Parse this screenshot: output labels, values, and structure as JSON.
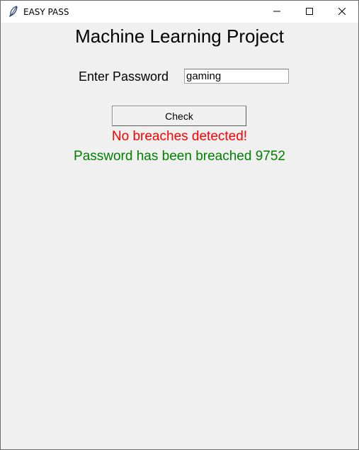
{
  "window": {
    "title": "EASY PASS",
    "icon": "feather-icon",
    "controls": [
      "minimize-icon",
      "maximize-icon",
      "close-icon"
    ]
  },
  "main": {
    "heading": "Machine Learning Project",
    "password_label": "Enter Password",
    "password_value": "gaming",
    "check_button_label": "Check",
    "status_message": "No breaches detected!",
    "result_message": "Password has been breached 9752"
  },
  "colors": {
    "status_message": "#ff0000",
    "result_message": "#008000",
    "background": "#f0f0f0"
  }
}
